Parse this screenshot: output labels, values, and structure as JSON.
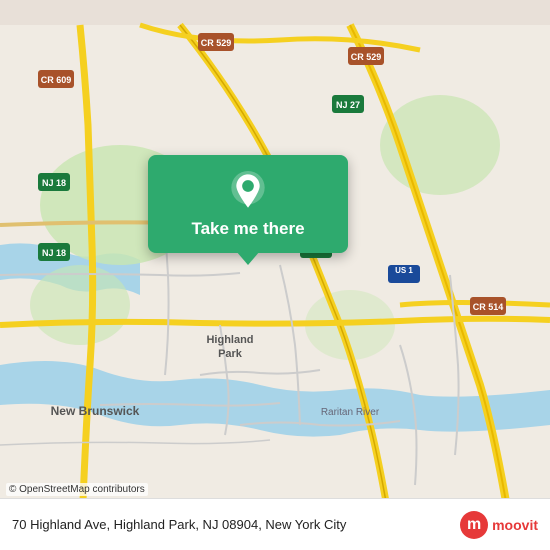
{
  "map": {
    "background_color": "#e8e0d8",
    "credit": "© OpenStreetMap contributors"
  },
  "popup": {
    "button_label": "Take me there",
    "background_color": "#2eaa6e",
    "icon": "location-pin"
  },
  "bottom_bar": {
    "address": "70 Highland Ave, Highland Park, NJ 08904, New York City",
    "logo_text": "moovit"
  }
}
